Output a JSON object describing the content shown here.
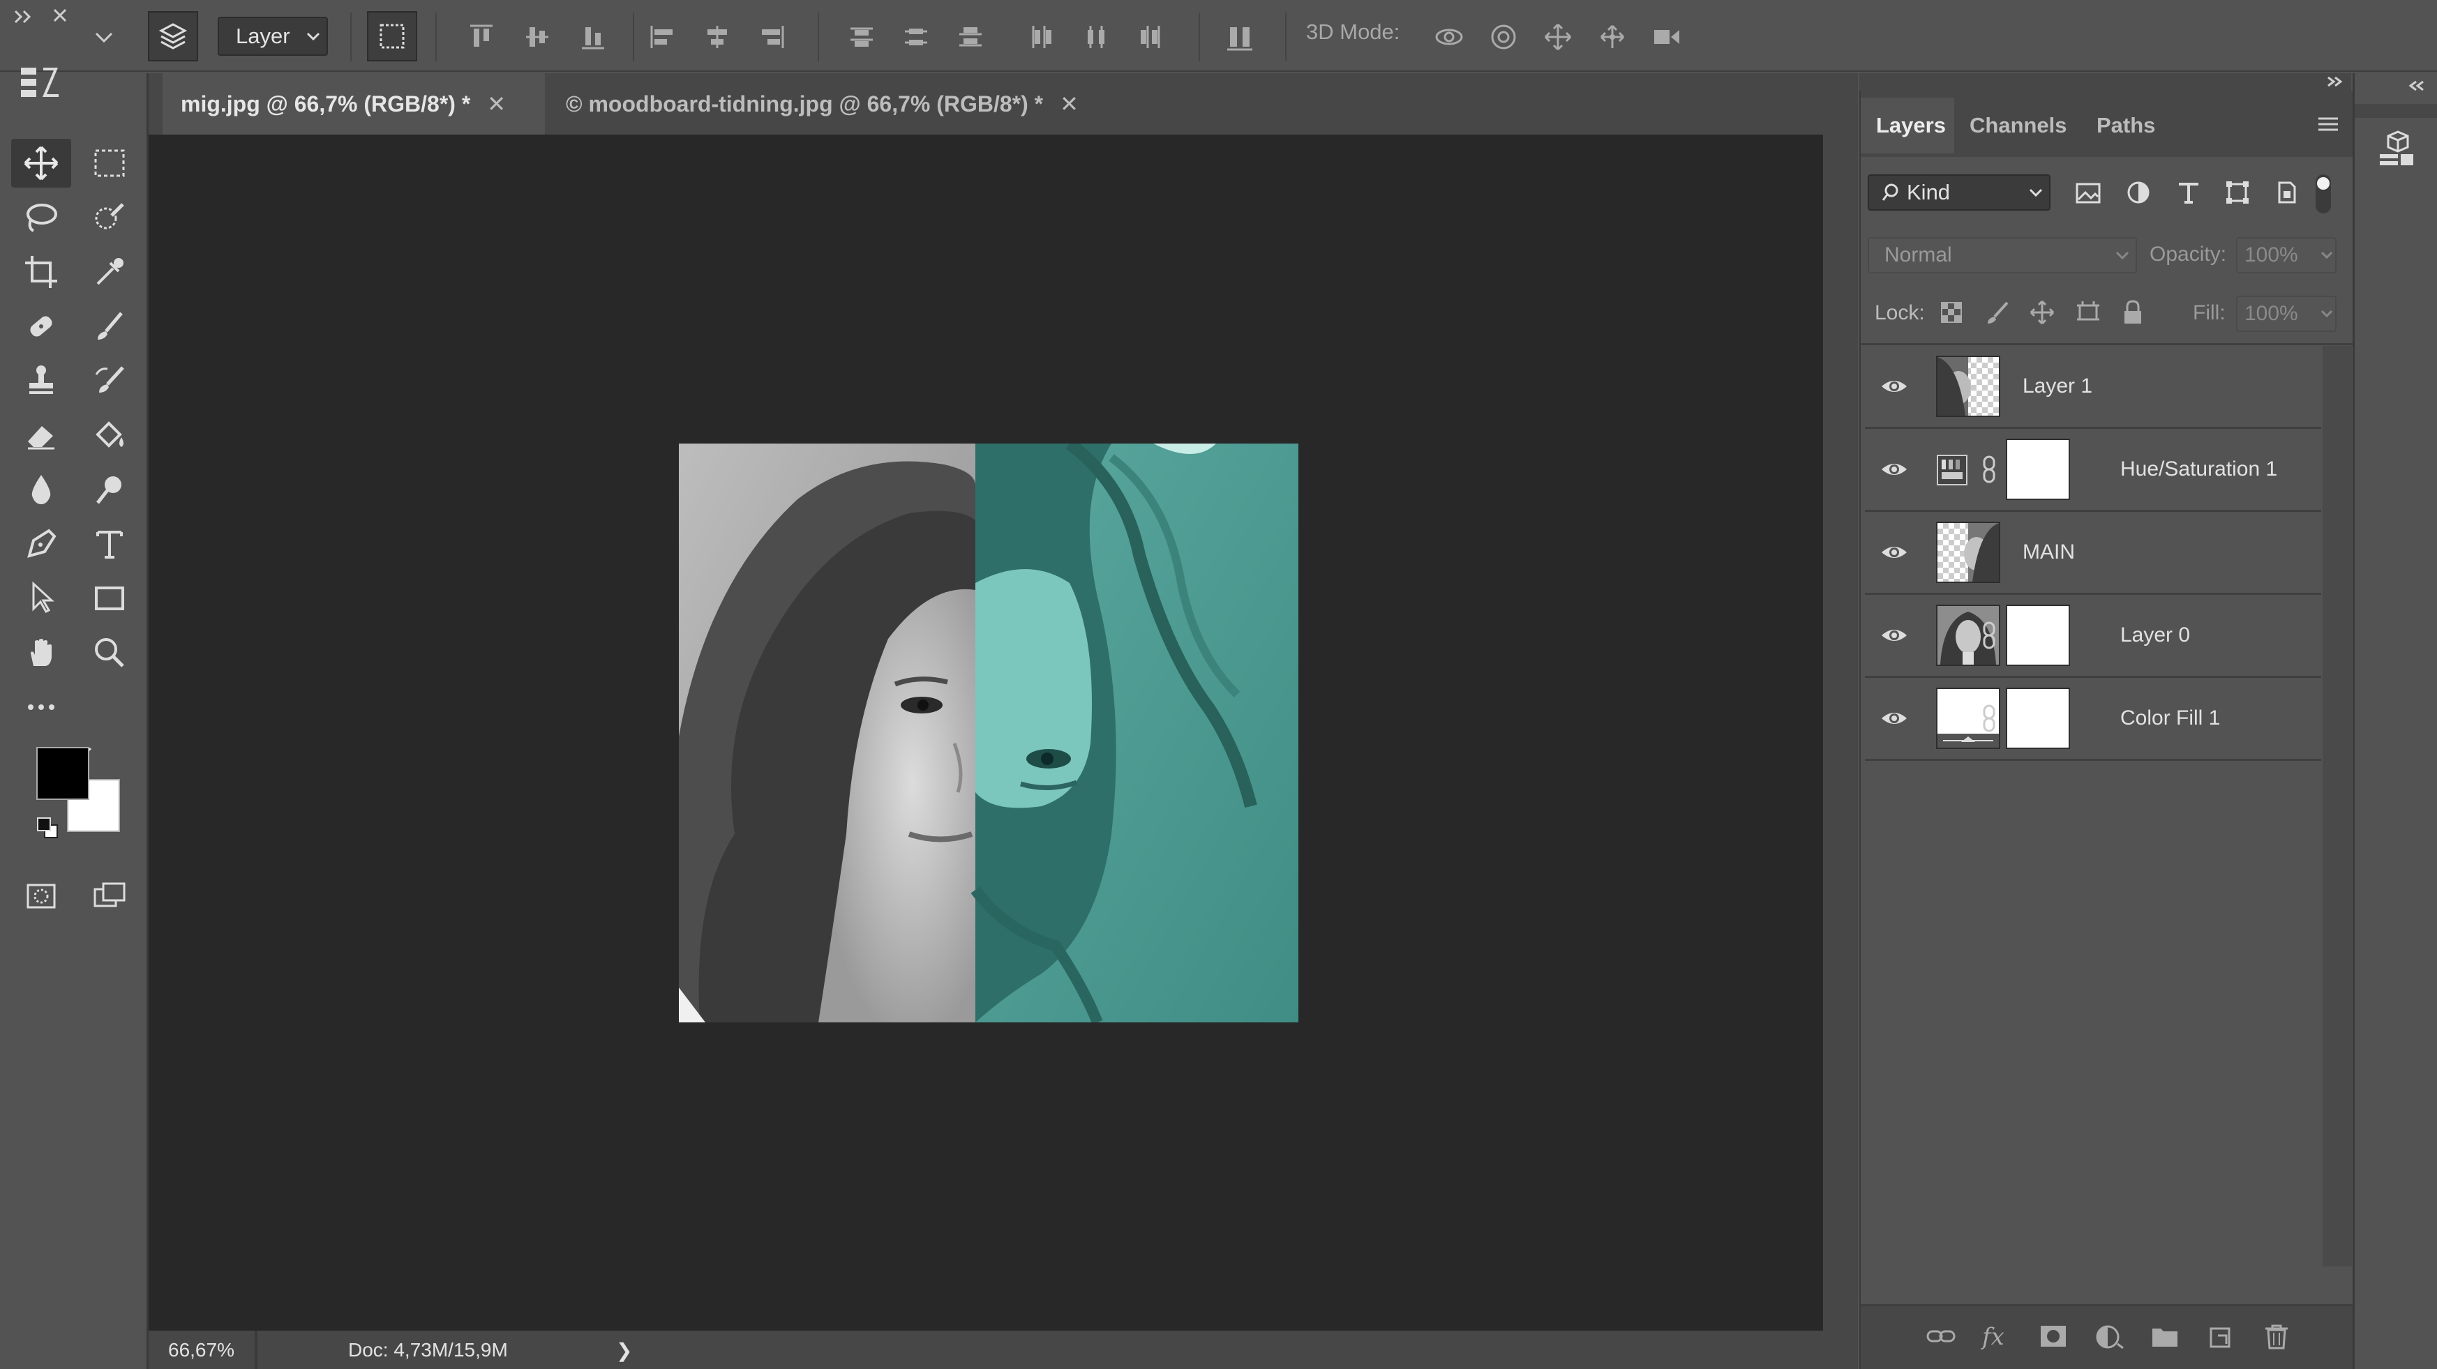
{
  "options_bar": {
    "auto_select_value": "Layer",
    "mode_3d_label": "3D Mode:"
  },
  "document_tabs": [
    {
      "label": "mig.jpg @ 66,7% (RGB/8*) *",
      "active": true
    },
    {
      "label": "© moodboard-tidning.jpg @ 66,7% (RGB/8*) *",
      "active": false
    }
  ],
  "status": {
    "zoom": "66,67%",
    "doc_info": "Doc: 4,73M/15,9M",
    "arrow": "❯"
  },
  "colors": {
    "foreground": "#000000",
    "background": "#ffffff",
    "teal_tint": "#4a9e95"
  },
  "layers_panel": {
    "tabs": [
      "Layers",
      "Channels",
      "Paths"
    ],
    "active_tab": "Layers",
    "filter_kind": "Kind",
    "blend_mode": "Normal",
    "opacity_label": "Opacity:",
    "opacity_value": "100%",
    "lock_label": "Lock:",
    "fill_label": "Fill:",
    "fill_value": "100%",
    "layers": [
      {
        "name": "Layer 1",
        "visible": true,
        "thumb": "photo-partial",
        "mask": false,
        "adjustment": false
      },
      {
        "name": "Hue/Saturation 1",
        "visible": true,
        "thumb": "adjustment",
        "mask": true,
        "adjustment": true
      },
      {
        "name": "MAIN",
        "visible": true,
        "thumb": "photo-half",
        "mask": false,
        "adjustment": false
      },
      {
        "name": "Layer 0",
        "visible": true,
        "thumb": "photo",
        "mask": true,
        "adjustment": false
      },
      {
        "name": "Color Fill 1",
        "visible": true,
        "thumb": "fill",
        "mask": true,
        "adjustment": true
      }
    ]
  },
  "tools": [
    "move-tool",
    "marquee-tool",
    "lasso-tool",
    "quick-select-tool",
    "crop-tool",
    "eyedropper-tool",
    "healing-brush-tool",
    "brush-tool",
    "clone-stamp-tool",
    "history-brush-tool",
    "eraser-tool",
    "paint-bucket-tool",
    "blur-tool",
    "dodge-tool",
    "pen-tool",
    "type-tool",
    "path-select-tool",
    "rectangle-tool",
    "hand-tool",
    "zoom-tool"
  ]
}
